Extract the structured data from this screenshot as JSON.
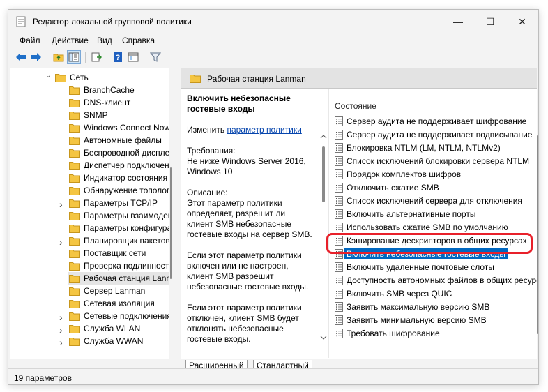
{
  "window": {
    "title": "Редактор локальной групповой политики",
    "controls": [
      "—",
      "☐",
      "✕"
    ]
  },
  "menu": [
    "Файл",
    "Действие",
    "Вид",
    "Справка"
  ],
  "tree": {
    "root": "Сеть",
    "items": [
      {
        "label": "BranchCache",
        "expandable": false
      },
      {
        "label": "DNS-клиент",
        "expandable": false
      },
      {
        "label": "SNMP",
        "expandable": false
      },
      {
        "label": "Windows Connect Now",
        "expandable": false
      },
      {
        "label": "Автономные файлы",
        "expandable": false
      },
      {
        "label": "Беспроводной дисплей",
        "expandable": false
      },
      {
        "label": "Диспетчер подключений",
        "expandable": false
      },
      {
        "label": "Индикатор состояния",
        "expandable": false
      },
      {
        "label": "Обнаружение топологии",
        "expandable": false
      },
      {
        "label": "Параметры TCP/IP",
        "expandable": true
      },
      {
        "label": "Параметры взаимодействия",
        "expandable": false
      },
      {
        "label": "Параметры конфигурации",
        "expandable": false
      },
      {
        "label": "Планировщик пакетов",
        "expandable": true
      },
      {
        "label": "Поставщик сети",
        "expandable": false
      },
      {
        "label": "Проверка подлинности",
        "expandable": false
      },
      {
        "label": "Рабочая станция Lanman",
        "expandable": false,
        "selected": true
      },
      {
        "label": "Сервер Lanman",
        "expandable": false
      },
      {
        "label": "Сетевая изоляция",
        "expandable": false
      },
      {
        "label": "Сетевые подключения",
        "expandable": true
      },
      {
        "label": "Служба WLAN",
        "expandable": true
      },
      {
        "label": "Служба WWAN",
        "expandable": true
      }
    ]
  },
  "right": {
    "header": "Рабочая станция Lanman",
    "desc_title": "Включить небезопасные гостевые входы",
    "change_prefix": "Изменить",
    "change_link": "параметр политики",
    "requirements": "Требования:\nНе ниже Windows Server 2016, Windows 10",
    "description": "Описание:\nЭтот параметр политики определяет, разрешит ли клиент SMB небезопасные гостевые входы на сервер SMB.",
    "p2": "Если этот параметр политики включен или не настроен, клиент SMB разрешит небезопасные гостевые входы.",
    "p3": "Если этот параметр политики отключен, клиент SMB будет отклонять небезопасные гостевые входы.",
    "list_header": "Состояние",
    "list": [
      {
        "label": "Сервер аудита не поддерживает шифрование"
      },
      {
        "label": "Сервер аудита не поддерживает подписывание"
      },
      {
        "label": "Блокировка NTLM (LM, NTLM, NTLMv2)"
      },
      {
        "label": "Список исключений блокировки сервера NTLM"
      },
      {
        "label": "Порядок комплектов шифров"
      },
      {
        "label": "Отключить сжатие SMB"
      },
      {
        "label": "Список исключений сервера для отключения"
      },
      {
        "label": "Включить альтернативные порты"
      },
      {
        "label": "Использовать сжатие SMB по умолчанию"
      },
      {
        "label": "Кэширование дескрипторов в общих ресурсах"
      },
      {
        "label": "Включить небезопасные гостевые входы",
        "selected": true
      },
      {
        "label": "Включить удаленные почтовые слоты"
      },
      {
        "label": "Доступность автономных файлов в общих ресурсах"
      },
      {
        "label": "Включить SMB через QUIC"
      },
      {
        "label": "Заявить максимальную версию SMB"
      },
      {
        "label": "Заявить минимальную версию SMB"
      },
      {
        "label": "Требовать шифрование"
      }
    ]
  },
  "tabs": [
    "Расширенный",
    "Стандартный"
  ],
  "status": "19 параметров",
  "colors": {
    "selection": "#0067c0",
    "highlight": "#e8202a",
    "folder": "#f4c542"
  }
}
